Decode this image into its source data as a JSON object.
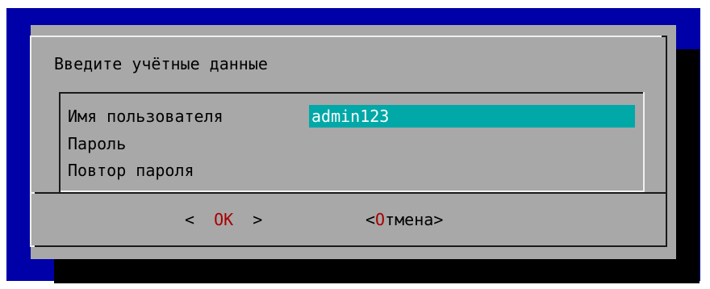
{
  "dialog": {
    "title": "Введите учётные данные"
  },
  "form": {
    "fields": [
      {
        "label": "Имя пользователя",
        "value": "admin123"
      },
      {
        "label": "Пароль",
        "value": ""
      },
      {
        "label": "Повтор пароля",
        "value": ""
      }
    ]
  },
  "buttons": {
    "ok": {
      "left": "<  ",
      "hotkey": "O",
      "rest": "K",
      "right": "  >"
    },
    "cancel": {
      "left": "<",
      "hotkey": "О",
      "rest": "тмена",
      "right": ">"
    }
  },
  "colors": {
    "background": "#0000a8",
    "dialog": "#a8a8a8",
    "shadow": "#000000",
    "selected_field": "#00a8a8",
    "hotkey": "#a80000"
  }
}
